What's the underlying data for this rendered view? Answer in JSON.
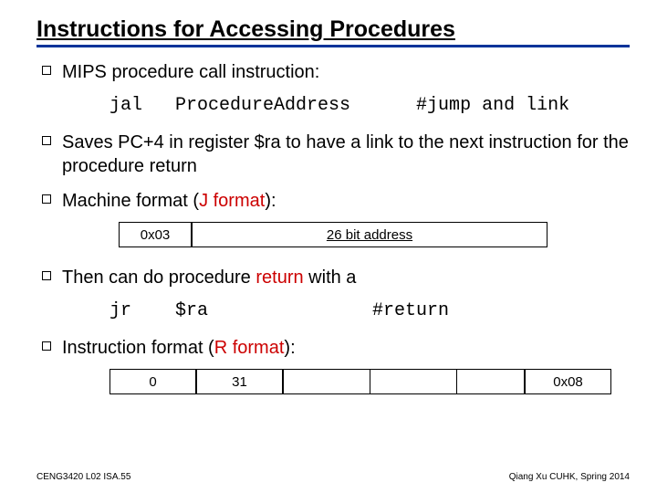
{
  "title": "Instructions for Accessing Procedures",
  "bullets": {
    "b1": "MIPS procedure call instruction:",
    "b2": "Saves PC+4 in register $ra to have a link to the next instruction for the procedure return",
    "b3_pre": "Machine format (",
    "b3_red": "J format",
    "b3_post": "):",
    "b4_pre": "Then can do procedure ",
    "b4_red": "return",
    "b4_post": " with a",
    "b5_pre": "Instruction format (",
    "b5_red": "R format",
    "b5_post": "):"
  },
  "code1": "jal   ProcedureAddress      #jump and link",
  "code2": "jr    $ra               #return",
  "jformat": {
    "opcode": "0x03",
    "addr": "26 bit address"
  },
  "rformat": {
    "c0": "0",
    "c1": "31",
    "c2": "",
    "c3": "",
    "c4": "",
    "c5": "0x08"
  },
  "footer": {
    "left": "CENG3420 L02 ISA.55",
    "right": "Qiang Xu   CUHK, Spring 2014"
  }
}
